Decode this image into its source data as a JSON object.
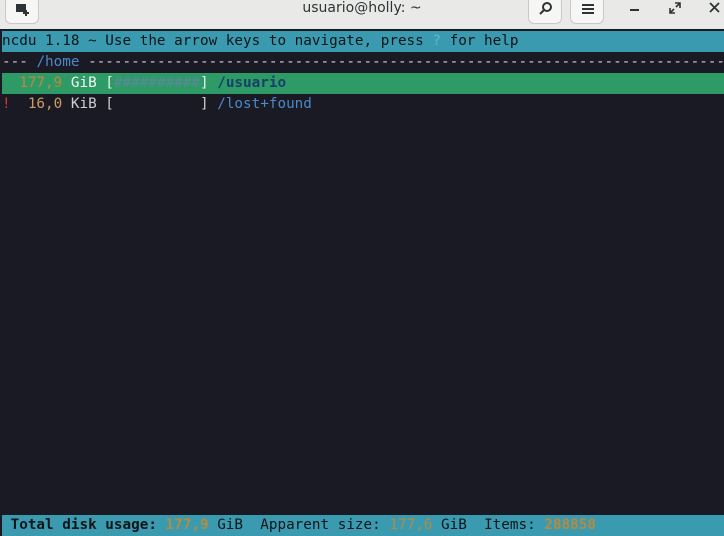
{
  "window": {
    "title": "usuario@holly: ~"
  },
  "icons": {
    "new_tab": "new-tab-icon",
    "search": "search-icon",
    "menu": "hamburger-menu-icon",
    "minimize": "minimize-icon",
    "maximize": "maximize-icon",
    "close": "close-icon"
  },
  "ncdu": {
    "header_prefix": "ncdu 1.18 ~ Use the arrow keys to navigate, press ",
    "help_key": "?",
    "header_suffix": " for help",
    "path_prefix": "--- ",
    "current_path": "/home",
    "path_dashes": " -------------------------------------------------------------------------------------",
    "entries": [
      {
        "flag": " ",
        "size": "177,9",
        "unit": "GiB",
        "graph_open": " [",
        "graph": "##########",
        "graph_close": "]",
        "name": "/usuario",
        "selected": true
      },
      {
        "flag": "!",
        "size": "16,0",
        "unit": "KiB",
        "graph_open": " [",
        "graph": "          ",
        "graph_close": "]",
        "name": "/lost+found",
        "selected": false
      }
    ],
    "footer": {
      "total_label": "Total disk usage:",
      "total_value": "177,9",
      "total_unit": "GiB",
      "apparent_label": "Apparent size:",
      "apparent_value": "177,6",
      "apparent_unit": "GiB",
      "items_label": "Items:",
      "items_value": "288858"
    }
  },
  "colors": {
    "terminal_bg": "#1a1a25",
    "status_bar": "#3a9bb0",
    "selected_row": "#2e9a66",
    "error_flag": "#d33b32"
  }
}
